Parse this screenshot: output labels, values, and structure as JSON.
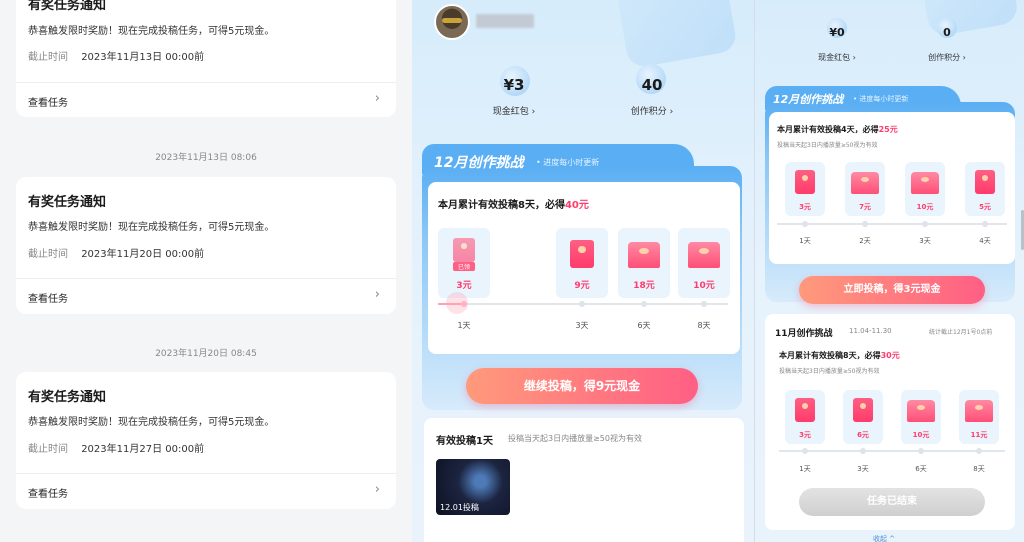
{
  "left_panel": {
    "card1": {
      "title": "有奖任务通知",
      "desc": "恭喜触发限时奖励！现在完成投稿任务，可得5元现金。",
      "deadline_label": "截止时间",
      "deadline_value": "2023年11月13日 00:00前",
      "link": "查看任务"
    },
    "ts2": "2023年11月13日 08:06",
    "card2": {
      "title": "有奖任务通知",
      "desc": "恭喜触发限时奖励！现在完成投稿任务，可得5元现金。",
      "deadline_label": "截止时间",
      "deadline_value": "2023年11月20日 00:00前",
      "link": "查看任务"
    },
    "ts3": "2023年11月20日 08:45",
    "card3": {
      "title": "有奖任务通知",
      "desc": "恭喜触发限时奖励！现在完成投稿任务，可得5元现金。",
      "deadline_label": "截止时间",
      "deadline_value": "2023年11月27日 00:00前",
      "link": "查看任务"
    }
  },
  "middle_panel": {
    "cash_value": "¥3",
    "cash_label": "现金红包 ›",
    "points_value": "40",
    "points_label": "创作积分 ›",
    "challenge_title": "12月创作挑战",
    "challenge_sub": "• 进度每小时更新",
    "goal_text": "本月累计有效投稿8天，必得",
    "goal_amount": "40元",
    "claimed_tag": "已领",
    "rewards": [
      {
        "amount": "3元",
        "day": "1天"
      },
      {
        "amount": "9元",
        "day": "3天"
      },
      {
        "amount": "18元",
        "day": "6天"
      },
      {
        "amount": "10元",
        "day": "8天"
      }
    ],
    "cta_label": "继续投稿，得9元现金",
    "valid_title": "有效投稿1天",
    "valid_note": "投稿当天起3日内播放量≥50视为有效",
    "thumb_label": "12.01投稿"
  },
  "right_panel": {
    "cash_value": "¥0",
    "cash_label": "现金红包 ›",
    "points_value": "0",
    "points_label": "创作积分 ›",
    "challenge_title": "12月创作挑战",
    "challenge_sub": "• 进度每小时更新",
    "goal_text": "本月累计有效投稿4天，必得",
    "goal_amount": "25元",
    "note": "投稿当天起3日内播放量≥50视为有效",
    "rewards": [
      {
        "amount": "3元",
        "day": "1天"
      },
      {
        "amount": "7元",
        "day": "2天"
      },
      {
        "amount": "10元",
        "day": "3天"
      },
      {
        "amount": "5元",
        "day": "4天"
      }
    ],
    "cta_label": "立即投稿，得3元现金",
    "nov_title": "11月创作挑战",
    "nov_range": "11.04-11.30",
    "nov_stat": "统计截止12月1号0点前",
    "nov_goal_text": "本月累计有效投稿8天，必得",
    "nov_goal_amount": "30元",
    "nov_note": "投稿当天起3日内播放量≥50视为有效",
    "nov_rewards": [
      {
        "amount": "3元",
        "day": "1天"
      },
      {
        "amount": "6元",
        "day": "3天"
      },
      {
        "amount": "10元",
        "day": "6天"
      },
      {
        "amount": "11元",
        "day": "8天"
      }
    ],
    "ended_label": "任务已结束",
    "bottom_hint": "收起 ^"
  }
}
